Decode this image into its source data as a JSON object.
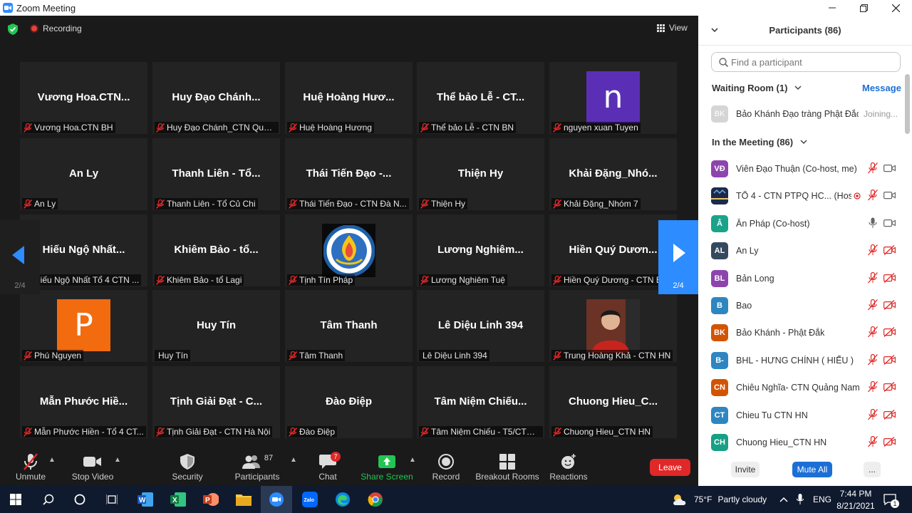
{
  "window": {
    "title": "Zoom Meeting"
  },
  "meeting": {
    "recording_label": "Recording",
    "view_label": "View"
  },
  "pager": {
    "left_page": "2/4",
    "right_page": "2/4"
  },
  "tiles": [
    {
      "display": "Vương  Hoa.CTN...",
      "label": "Vương Hoa.CTN BH",
      "muted": true
    },
    {
      "display": "Huy  Đạo  Chánh...",
      "label": "Huy Đạo Chánh_CTN Quản...",
      "muted": true
    },
    {
      "display": "Huệ  Hoàng  Hươ...",
      "label": "Huệ Hoàng Hương",
      "muted": true
    },
    {
      "display": "Thể  bảo  Lễ  -  CT...",
      "label": "Thể bảo Lễ - CTN BN",
      "muted": true
    },
    {
      "display": "",
      "label": "nguyen xuan Tuyen",
      "muted": true,
      "avatar": {
        "letter": "n",
        "color": "#5b2fb5"
      }
    },
    {
      "display": "An  Ly",
      "label": "An Ly",
      "muted": true
    },
    {
      "display": "Thanh  Liên  -  Tổ...",
      "label": "Thanh Liên - Tổ Củ Chi",
      "muted": true
    },
    {
      "display": "Thái  Tiến  Đạo  -...",
      "label": "Thái Tiến Đạo - CTN Đà N...",
      "muted": true
    },
    {
      "display": "Thiện  Hy",
      "label": "Thiện Hy",
      "muted": true
    },
    {
      "display": "Khải  Đặng_Nhó...",
      "label": "Khải Đặng_Nhóm 7",
      "muted": true
    },
    {
      "display": "Hiếu  Ngộ  Nhất...",
      "label": "Hiếu Ngộ Nhất Tổ 4 CTN ...",
      "muted": true
    },
    {
      "display": "Khiêm  Bảo  -  tổ...",
      "label": "Khiêm Bảo - tổ Lagi",
      "muted": true
    },
    {
      "display": "",
      "label": "Tịnh Tín Pháp",
      "muted": true,
      "avatar": {
        "logo": true
      }
    },
    {
      "display": "Lương  Nghiêm...",
      "label": "Lương Nghiêm Tuệ",
      "muted": true
    },
    {
      "display": "Hiền  Quý  Dươn...",
      "label": "Hiền Quý Dương - CTN Bìn...",
      "muted": true
    },
    {
      "display": "",
      "label": "Phú Nguyen",
      "muted": true,
      "avatar": {
        "letter": "P",
        "color": "#f26b0f"
      }
    },
    {
      "display": "Huy  Tín",
      "label": "Huy Tín",
      "muted": false
    },
    {
      "display": "Tâm  Thanh",
      "label": "Tâm Thanh",
      "muted": true
    },
    {
      "display": "Lê  Diệu  Linh  394",
      "label": "Lê Diệu Linh 394",
      "muted": false
    },
    {
      "display": "",
      "label": "Trung Hoàng Khả - CTN HN",
      "muted": true,
      "avatar": {
        "photo": true
      }
    },
    {
      "display": "Mẫn  Phước  Hiề...",
      "label": "Mẫn Phước Hiền - Tổ 4 CT...",
      "muted": true
    },
    {
      "display": "Tịnh  Giải  Đạt  -  C...",
      "label": "Tịnh Giải Đạt - CTN Hà Nội",
      "muted": true
    },
    {
      "display": "Đào  Điệp",
      "label": "Đào Điệp",
      "muted": true
    },
    {
      "display": "Tâm  Niệm  Chiếu...",
      "label": "Tâm Niệm Chiếu - T5/CTN ...",
      "muted": true
    },
    {
      "display": "Chuong  Hieu_C...",
      "label": "Chuong Hieu_CTN HN",
      "muted": true
    }
  ],
  "toolbar": {
    "unmute": "Unmute",
    "stop_video": "Stop Video",
    "security": "Security",
    "participants": "Participants",
    "participants_count": "87",
    "chat": "Chat",
    "chat_badge": "7",
    "share_screen": "Share Screen",
    "record": "Record",
    "breakout": "Breakout Rooms",
    "reactions": "Reactions",
    "leave": "Leave"
  },
  "panel": {
    "title": "Participants (86)",
    "search_placeholder": "Find a participant",
    "waiting_room": "Waiting Room (1)",
    "message": "Message",
    "waiting": {
      "initials": "BK",
      "name": "Bảo Khánh Đạo tràng Phật Đắc",
      "status": "Joining..."
    },
    "in_meeting": "In the Meeting (86)",
    "participants": [
      {
        "initials": "VĐ",
        "color": "#8e44ad",
        "name": "Viên Đạo Thuận (Co-host, me)",
        "mic": "muted",
        "cam": "on"
      },
      {
        "initials": "",
        "color": "#1c2a4a",
        "name": "TỔ 4 - CTN PTPQ HC... (Host)",
        "mic": "muted",
        "cam": "on",
        "image": true
      },
      {
        "initials": "Â",
        "color": "#1aa38a",
        "name": "Ân Pháp (Co-host)",
        "mic": "on",
        "cam": "on"
      },
      {
        "initials": "AL",
        "color": "#34495e",
        "name": "An Ly",
        "mic": "muted",
        "cam": "off"
      },
      {
        "initials": "BL",
        "color": "#8e44ad",
        "name": "Bản Long",
        "mic": "muted",
        "cam": "off"
      },
      {
        "initials": "B",
        "color": "#2e86c1",
        "name": "Bao",
        "mic": "muted",
        "cam": "off"
      },
      {
        "initials": "BK",
        "color": "#d35400",
        "name": "Bảo Khánh - Phật Đắk",
        "mic": "muted",
        "cam": "off"
      },
      {
        "initials": "B-",
        "color": "#2e86c1",
        "name": "BHL - HƯNG CHÍNH ( HIẾU )",
        "mic": "muted",
        "cam": "off"
      },
      {
        "initials": "CN",
        "color": "#d35400",
        "name": "Chiêu Nghĩa- CTN Quảng Nam",
        "mic": "muted",
        "cam": "off"
      },
      {
        "initials": "CT",
        "color": "#2e86c1",
        "name": "Chieu Tu CTN HN",
        "mic": "muted",
        "cam": "off"
      },
      {
        "initials": "CH",
        "color": "#16a085",
        "name": "Chuong Hieu_CTN HN",
        "mic": "muted",
        "cam": "off"
      }
    ],
    "invite": "Invite",
    "mute_all": "Mute All",
    "more": "..."
  },
  "taskbar": {
    "temperature": "75°F",
    "weather": "Partly cloudy",
    "language": "ENG",
    "time": "7:44 PM",
    "date": "8/21/2021",
    "notification_count": "1"
  }
}
